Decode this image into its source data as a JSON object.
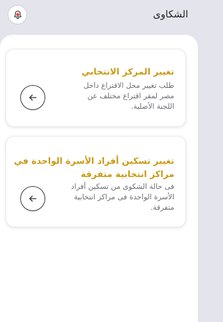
{
  "header": {
    "title": "الشكاوى",
    "notification_icon": "bell-icon",
    "notification_badge_color": "#e53935"
  },
  "cards": [
    {
      "title": "تغيير المركز الانتخابي",
      "description": "طلب تغيير محل الاقتراع داخل مصر لمقر اقتراع مختلف عن اللجنة الأصلية.",
      "icon": "arrow-left-icon"
    },
    {
      "title": "تغيير تسكين أفراد الأسرة الواحدة في مراكز انتخابية متفرقة",
      "description": "فى حالة الشكوى من تسكين أفراد الأسرة الواحدة فى مراكز انتخابية متفرقة.",
      "icon": "arrow-left-icon"
    }
  ],
  "colors": {
    "accent": "#c99a14",
    "background": "#e4e4ec",
    "panel": "#ffffff"
  }
}
